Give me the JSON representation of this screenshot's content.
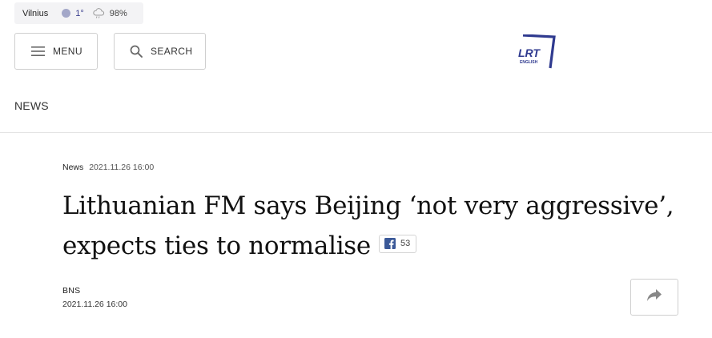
{
  "weather": {
    "city": "Vilnius",
    "temperature": "1°",
    "humidity": "98%",
    "icon": "cloud-rain-icon"
  },
  "header": {
    "menu_label": "MENU",
    "search_label": "SEARCH",
    "logo": {
      "text": "LRT",
      "subtext": "ENGLISH",
      "color": "#2f3a8f"
    }
  },
  "section": {
    "title": "NEWS"
  },
  "article": {
    "category": "News",
    "published": "2021.11.26 16:00",
    "headline": "Lithuanian FM says Beijing ‘not very aggressive’, expects ties to normalise",
    "facebook_count": "53",
    "author": "BNS",
    "author_date": "2021.11.26 16:00"
  },
  "colors": {
    "accent": "#3a3f8f",
    "facebook": "#3b5998",
    "border": "#cfcfcf"
  }
}
